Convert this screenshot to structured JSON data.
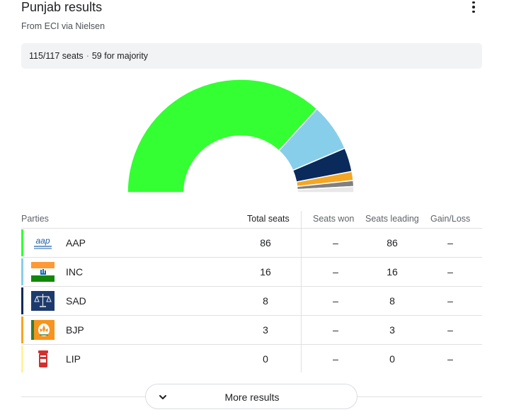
{
  "header": {
    "title": "Punjab results",
    "subtitle": "From ECI via Nielsen",
    "menu_icon": "more-vert-icon"
  },
  "summary": {
    "seats": "115/117 seats",
    "separator": "·",
    "majority": "59 for majority"
  },
  "chart_data": {
    "type": "pie",
    "shape": "semicircle-donut",
    "total_seats": 117,
    "slices": [
      {
        "name": "AAP",
        "value": 86,
        "color": "#33ff33"
      },
      {
        "name": "INC",
        "value": 16,
        "color": "#87ceeb"
      },
      {
        "name": "SAD",
        "value": 8,
        "color": "#0a2a5c"
      },
      {
        "name": "BJP",
        "value": 3,
        "color": "#f5a623"
      },
      {
        "name": "Others",
        "value": 2,
        "color": "#808080"
      },
      {
        "name": "Undeclared",
        "value": 2,
        "color": "#e8e8e8"
      }
    ]
  },
  "table": {
    "headers": {
      "parties": "Parties",
      "total": "Total seats",
      "won": "Seats won",
      "leading": "Seats leading",
      "gain": "Gain/Loss"
    },
    "rows": [
      {
        "party": "AAP",
        "total": "86",
        "won": "–",
        "leading": "86",
        "gain": "–",
        "color": "#33ff33",
        "logo": "aap-logo-icon"
      },
      {
        "party": "INC",
        "total": "16",
        "won": "–",
        "leading": "16",
        "gain": "–",
        "color": "#87ceeb",
        "logo": "inc-logo-icon"
      },
      {
        "party": "SAD",
        "total": "8",
        "won": "–",
        "leading": "8",
        "gain": "–",
        "color": "#0a2a5c",
        "logo": "sad-logo-icon"
      },
      {
        "party": "BJP",
        "total": "3",
        "won": "–",
        "leading": "3",
        "gain": "–",
        "color": "#f5a623",
        "logo": "bjp-logo-icon"
      },
      {
        "party": "LIP",
        "total": "0",
        "won": "–",
        "leading": "0",
        "gain": "–",
        "color": "#fff3a0",
        "logo": "lip-logo-icon"
      }
    ]
  },
  "more": {
    "label": "More results",
    "icon": "chevron-down-icon"
  }
}
